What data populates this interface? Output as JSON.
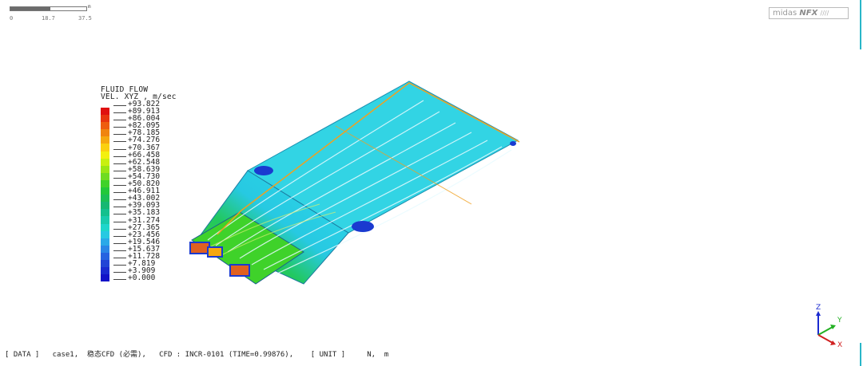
{
  "scale_bar": {
    "unit": "m",
    "ticks": [
      "0",
      "18.7",
      "37.5"
    ]
  },
  "logo": {
    "prefix": "midas",
    "brand": "NFX"
  },
  "legend": {
    "title_line1": "FLUID FLOW",
    "title_line2": "VEL. XYZ , m/sec",
    "values": [
      "+93.822",
      "+89.913",
      "+86.004",
      "+82.095",
      "+78.185",
      "+74.276",
      "+70.367",
      "+66.458",
      "+62.548",
      "+58.639",
      "+54.730",
      "+50.820",
      "+46.911",
      "+43.002",
      "+39.093",
      "+35.183",
      "+31.274",
      "+27.365",
      "+23.456",
      "+19.546",
      "+15.637",
      "+11.728",
      "+7.819",
      "+3.909",
      "+0.000"
    ],
    "colors": [
      "#e01010",
      "#e83510",
      "#ee5d10",
      "#f08410",
      "#f6a810",
      "#fbd010",
      "#f3f010",
      "#c8f010",
      "#9be614",
      "#6fdc20",
      "#3fd22a",
      "#22c83a",
      "#1bbf55",
      "#17b872",
      "#15c08e",
      "#19cbad",
      "#1ed6cb",
      "#27c9e2",
      "#2aa9e8",
      "#2a86e6",
      "#2663e0",
      "#2244d6",
      "#1a2ad0",
      "#1212c8"
    ]
  },
  "status_bar": {
    "text": "[ DATA ]   case1,  稳态CFD (必需),   CFD : INCR-0101 (TIME=0.99876),    [ UNIT ]     N,  m"
  },
  "triad": {
    "z": "Z",
    "y": "Y",
    "x": "X"
  }
}
